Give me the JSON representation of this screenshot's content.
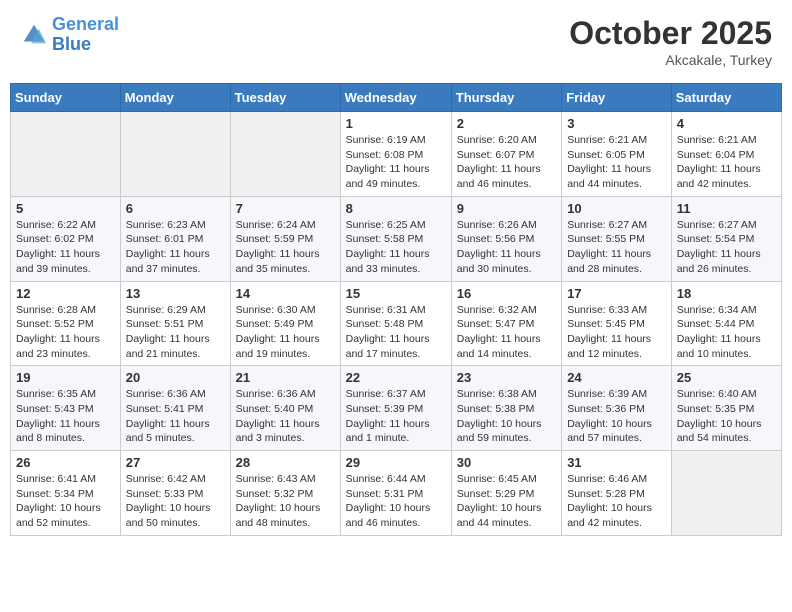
{
  "header": {
    "logo_line1": "General",
    "logo_line2": "Blue",
    "month": "October 2025",
    "location": "Akcakale, Turkey"
  },
  "weekdays": [
    "Sunday",
    "Monday",
    "Tuesday",
    "Wednesday",
    "Thursday",
    "Friday",
    "Saturday"
  ],
  "weeks": [
    [
      {
        "day": "",
        "info": ""
      },
      {
        "day": "",
        "info": ""
      },
      {
        "day": "",
        "info": ""
      },
      {
        "day": "1",
        "info": "Sunrise: 6:19 AM\nSunset: 6:08 PM\nDaylight: 11 hours and 49 minutes."
      },
      {
        "day": "2",
        "info": "Sunrise: 6:20 AM\nSunset: 6:07 PM\nDaylight: 11 hours and 46 minutes."
      },
      {
        "day": "3",
        "info": "Sunrise: 6:21 AM\nSunset: 6:05 PM\nDaylight: 11 hours and 44 minutes."
      },
      {
        "day": "4",
        "info": "Sunrise: 6:21 AM\nSunset: 6:04 PM\nDaylight: 11 hours and 42 minutes."
      }
    ],
    [
      {
        "day": "5",
        "info": "Sunrise: 6:22 AM\nSunset: 6:02 PM\nDaylight: 11 hours and 39 minutes."
      },
      {
        "day": "6",
        "info": "Sunrise: 6:23 AM\nSunset: 6:01 PM\nDaylight: 11 hours and 37 minutes."
      },
      {
        "day": "7",
        "info": "Sunrise: 6:24 AM\nSunset: 5:59 PM\nDaylight: 11 hours and 35 minutes."
      },
      {
        "day": "8",
        "info": "Sunrise: 6:25 AM\nSunset: 5:58 PM\nDaylight: 11 hours and 33 minutes."
      },
      {
        "day": "9",
        "info": "Sunrise: 6:26 AM\nSunset: 5:56 PM\nDaylight: 11 hours and 30 minutes."
      },
      {
        "day": "10",
        "info": "Sunrise: 6:27 AM\nSunset: 5:55 PM\nDaylight: 11 hours and 28 minutes."
      },
      {
        "day": "11",
        "info": "Sunrise: 6:27 AM\nSunset: 5:54 PM\nDaylight: 11 hours and 26 minutes."
      }
    ],
    [
      {
        "day": "12",
        "info": "Sunrise: 6:28 AM\nSunset: 5:52 PM\nDaylight: 11 hours and 23 minutes."
      },
      {
        "day": "13",
        "info": "Sunrise: 6:29 AM\nSunset: 5:51 PM\nDaylight: 11 hours and 21 minutes."
      },
      {
        "day": "14",
        "info": "Sunrise: 6:30 AM\nSunset: 5:49 PM\nDaylight: 11 hours and 19 minutes."
      },
      {
        "day": "15",
        "info": "Sunrise: 6:31 AM\nSunset: 5:48 PM\nDaylight: 11 hours and 17 minutes."
      },
      {
        "day": "16",
        "info": "Sunrise: 6:32 AM\nSunset: 5:47 PM\nDaylight: 11 hours and 14 minutes."
      },
      {
        "day": "17",
        "info": "Sunrise: 6:33 AM\nSunset: 5:45 PM\nDaylight: 11 hours and 12 minutes."
      },
      {
        "day": "18",
        "info": "Sunrise: 6:34 AM\nSunset: 5:44 PM\nDaylight: 11 hours and 10 minutes."
      }
    ],
    [
      {
        "day": "19",
        "info": "Sunrise: 6:35 AM\nSunset: 5:43 PM\nDaylight: 11 hours and 8 minutes."
      },
      {
        "day": "20",
        "info": "Sunrise: 6:36 AM\nSunset: 5:41 PM\nDaylight: 11 hours and 5 minutes."
      },
      {
        "day": "21",
        "info": "Sunrise: 6:36 AM\nSunset: 5:40 PM\nDaylight: 11 hours and 3 minutes."
      },
      {
        "day": "22",
        "info": "Sunrise: 6:37 AM\nSunset: 5:39 PM\nDaylight: 11 hours and 1 minute."
      },
      {
        "day": "23",
        "info": "Sunrise: 6:38 AM\nSunset: 5:38 PM\nDaylight: 10 hours and 59 minutes."
      },
      {
        "day": "24",
        "info": "Sunrise: 6:39 AM\nSunset: 5:36 PM\nDaylight: 10 hours and 57 minutes."
      },
      {
        "day": "25",
        "info": "Sunrise: 6:40 AM\nSunset: 5:35 PM\nDaylight: 10 hours and 54 minutes."
      }
    ],
    [
      {
        "day": "26",
        "info": "Sunrise: 6:41 AM\nSunset: 5:34 PM\nDaylight: 10 hours and 52 minutes."
      },
      {
        "day": "27",
        "info": "Sunrise: 6:42 AM\nSunset: 5:33 PM\nDaylight: 10 hours and 50 minutes."
      },
      {
        "day": "28",
        "info": "Sunrise: 6:43 AM\nSunset: 5:32 PM\nDaylight: 10 hours and 48 minutes."
      },
      {
        "day": "29",
        "info": "Sunrise: 6:44 AM\nSunset: 5:31 PM\nDaylight: 10 hours and 46 minutes."
      },
      {
        "day": "30",
        "info": "Sunrise: 6:45 AM\nSunset: 5:29 PM\nDaylight: 10 hours and 44 minutes."
      },
      {
        "day": "31",
        "info": "Sunrise: 6:46 AM\nSunset: 5:28 PM\nDaylight: 10 hours and 42 minutes."
      },
      {
        "day": "",
        "info": ""
      }
    ]
  ]
}
